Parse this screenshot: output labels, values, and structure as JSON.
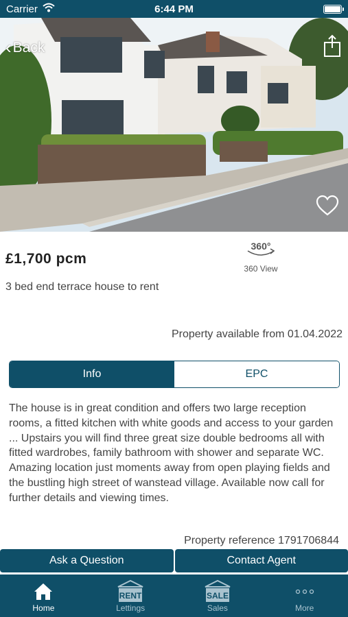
{
  "status_bar": {
    "carrier": "Carrier",
    "time": "6:44 PM"
  },
  "hero": {
    "back_label": "Back"
  },
  "property": {
    "price": "£1,700 pcm",
    "summary": "3 bed end terrace house to rent",
    "view_360_badge": "360°",
    "view_360_label": "360 View",
    "availability": "Property available from 01.04.2022",
    "reference": "Property reference 1791706844",
    "description": "The house is in great condition and offers two large reception rooms, a fitted kitchen with white goods and access to your garden ... Upstairs you will find three great size double bedrooms all with fitted wardrobes, family bathroom with shower and separate WC. Amazing location just moments away from open playing fields and the bustling high street of wanstead village. Available now call for further details and viewing times."
  },
  "tabs": [
    {
      "label": "Info",
      "active": true
    },
    {
      "label": "EPC",
      "active": false
    }
  ],
  "actions": {
    "ask_question": "Ask a Question",
    "contact_agent": "Contact Agent"
  },
  "tab_bar": {
    "items": [
      {
        "label": "Home",
        "icon": "home-icon",
        "badge": ""
      },
      {
        "label": "Lettings",
        "icon": "rent-sign-icon",
        "badge": "RENT"
      },
      {
        "label": "Sales",
        "icon": "sale-sign-icon",
        "badge": "SALE"
      },
      {
        "label": "More",
        "icon": "more-icon",
        "badge": ""
      }
    ]
  },
  "colors": {
    "brand": "#0f4f68",
    "brand_dim": "#a9c3cf"
  }
}
